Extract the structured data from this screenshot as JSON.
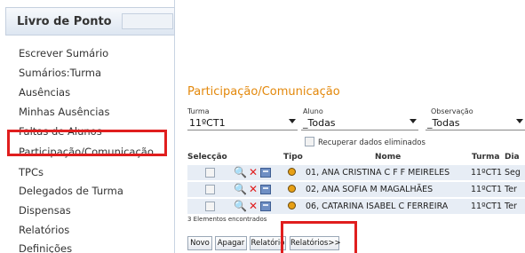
{
  "sidebar": {
    "title": "Livro de Ponto",
    "items": [
      {
        "label": "Escrever Sumário"
      },
      {
        "label": "Sumários:Turma"
      },
      {
        "label": "Ausências"
      },
      {
        "label": "Minhas Ausências"
      },
      {
        "label": "Faltas de Alunos"
      },
      {
        "label": "Participação/Comunicação"
      },
      {
        "label": "TPCs"
      },
      {
        "label": "Delegados de Turma"
      },
      {
        "label": "Dispensas"
      },
      {
        "label": "Relatórios"
      },
      {
        "label": "Definições"
      }
    ],
    "highlight_color": "#e01e1e"
  },
  "main": {
    "title": "Participação/Comunicação",
    "title_color": "#e3880b",
    "filters": {
      "turma_label": "Turma",
      "turma_value": "11ºCT1",
      "aluno_label": "Aluno",
      "aluno_value": "_Todas",
      "observacao_label": "Observação",
      "observacao_value": "_Todas"
    },
    "recover_label": "Recuperar dados eliminados",
    "table": {
      "headers": {
        "seleccao": "Selecção",
        "tipo": "Tipo",
        "nome": "Nome",
        "turma": "Turma",
        "dia": "Dia"
      },
      "rows": [
        {
          "nome": "01, ANA CRISTINA C F F MEIRELES",
          "turma": "11ºCT1",
          "dia": "Seg"
        },
        {
          "nome": "02, ANA SOFIA M MAGALHÃES",
          "turma": "11ºCT1",
          "dia": "Ter"
        },
        {
          "nome": "06, CATARINA ISABEL C FERREIRA",
          "turma": "11ºCT1",
          "dia": "Ter"
        }
      ],
      "row_color": "#e7edf5"
    },
    "count_text": "3 Elementos encontrados",
    "buttons": {
      "novo": "Novo",
      "apagar": "Apagar",
      "relatorio": "Relatório",
      "relatorios": "Relatórios>>"
    }
  }
}
